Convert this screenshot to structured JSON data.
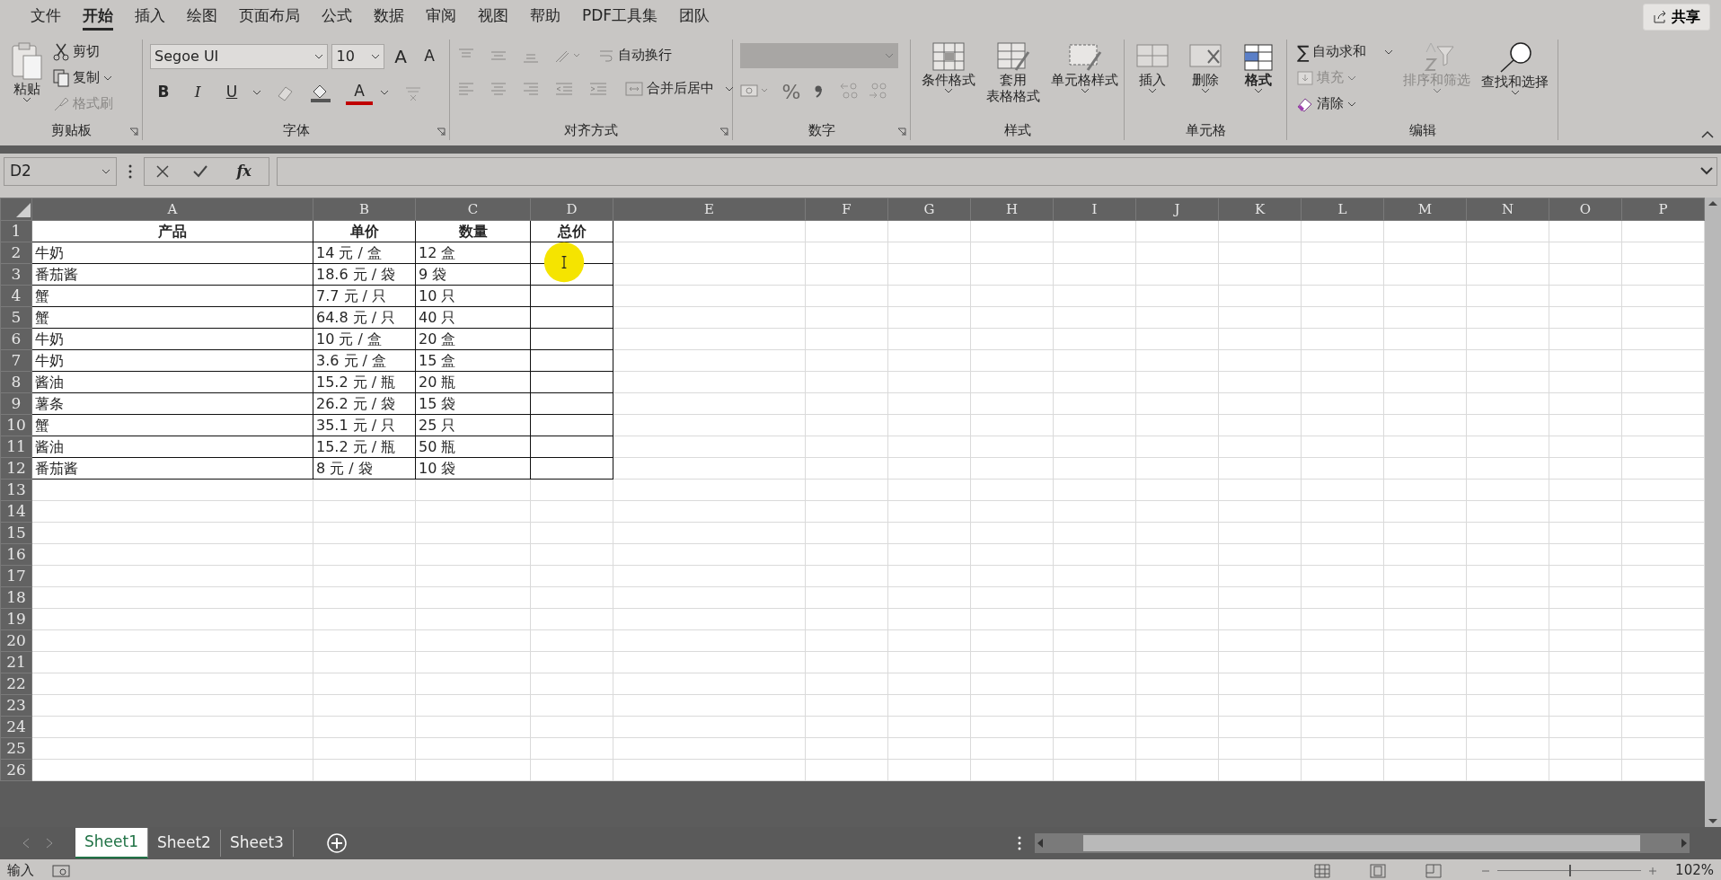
{
  "menu_tabs": [
    {
      "label": "文件",
      "selected": false
    },
    {
      "label": "开始",
      "selected": true
    },
    {
      "label": "插入",
      "selected": false
    },
    {
      "label": "绘图",
      "selected": false
    },
    {
      "label": "页面布局",
      "selected": false
    },
    {
      "label": "公式",
      "selected": false
    },
    {
      "label": "数据",
      "selected": false
    },
    {
      "label": "审阅",
      "selected": false
    },
    {
      "label": "视图",
      "selected": false
    },
    {
      "label": "帮助",
      "selected": false
    },
    {
      "label": "PDF工具集",
      "selected": false
    },
    {
      "label": "团队",
      "selected": false
    }
  ],
  "share_button": "共享",
  "clipboard": {
    "paste": "粘贴",
    "cut": {
      "label": "剪切",
      "disabled": false
    },
    "copy": {
      "label": "复制",
      "disabled": false
    },
    "format_painter": {
      "label": "格式刷",
      "disabled": true
    },
    "group_label": "剪贴板"
  },
  "font": {
    "font_name": "Segoe UI",
    "font_size": "10",
    "grow": "A",
    "shrink": "A",
    "bold": "B",
    "italic": "I",
    "underline": "U",
    "font_color": "A",
    "group_label": "字体"
  },
  "alignment": {
    "wrap_text": "自动换行",
    "merge_center": "合并后居中",
    "group_label": "对齐方式"
  },
  "number": {
    "percent": "%",
    "group_label": "数字"
  },
  "styles": {
    "conditional_format": "条件格式",
    "table_format_line1": "套用",
    "table_format_line2": "表格格式",
    "cell_styles": "单元格样式",
    "group_label": "样式"
  },
  "cells_group": {
    "insert": "插入",
    "delete": "删除",
    "format": "格式",
    "group_label": "单元格"
  },
  "editing": {
    "autosum": {
      "symbol": "∑",
      "label": "自动求和",
      "disabled": false
    },
    "fill": {
      "label": "填充",
      "disabled": true
    },
    "clear": {
      "label": "清除",
      "disabled": false
    },
    "sort_filter": {
      "label": "排序和筛选",
      "disabled": true
    },
    "find_select": {
      "label": "查找和选择",
      "disabled": false
    },
    "group_label": "编辑"
  },
  "formula_bar": {
    "name_box": "D2",
    "function_button": "fx"
  },
  "sheet": {
    "columns": [
      "A",
      "B",
      "C",
      "D",
      "E",
      "F",
      "G",
      "H",
      "I",
      "J",
      "K",
      "L",
      "M",
      "N",
      "O",
      "P"
    ],
    "rows": [
      {
        "number": "1",
        "kind": "header",
        "cells": [
          "产品",
          "单价",
          "数量",
          "总价"
        ]
      },
      {
        "number": "2",
        "kind": "data",
        "cells": [
          "牛奶",
          "14 元 / 盒",
          "12 盒",
          ""
        ]
      },
      {
        "number": "3",
        "kind": "data",
        "cells": [
          "番茄酱",
          "18.6 元 / 袋",
          "9 袋",
          ""
        ]
      },
      {
        "number": "4",
        "kind": "data",
        "cells": [
          "蟹",
          "7.7 元 / 只",
          "10 只",
          ""
        ]
      },
      {
        "number": "5",
        "kind": "data",
        "cells": [
          "蟹",
          "64.8 元 / 只",
          "40 只",
          ""
        ]
      },
      {
        "number": "6",
        "kind": "data",
        "cells": [
          "牛奶",
          "10 元 / 盒",
          "20 盒",
          ""
        ]
      },
      {
        "number": "7",
        "kind": "data",
        "cells": [
          "牛奶",
          "3.6 元 / 盒",
          "15 盒",
          ""
        ]
      },
      {
        "number": "8",
        "kind": "data",
        "cells": [
          "酱油",
          "15.2 元 / 瓶",
          "20 瓶",
          ""
        ]
      },
      {
        "number": "9",
        "kind": "data",
        "cells": [
          "薯条",
          "26.2 元 / 袋",
          "15 袋",
          ""
        ]
      },
      {
        "number": "10",
        "kind": "data",
        "cells": [
          "蟹",
          "35.1 元 / 只",
          "25 只",
          ""
        ]
      },
      {
        "number": "11",
        "kind": "data",
        "cells": [
          "酱油",
          "15.2 元 / 瓶",
          "50 瓶",
          ""
        ]
      },
      {
        "number": "12",
        "kind": "data",
        "cells": [
          "番茄酱",
          "8 元 / 袋",
          "10 袋",
          ""
        ]
      },
      {
        "number": "13"
      },
      {
        "number": "14"
      },
      {
        "number": "15"
      },
      {
        "number": "16"
      },
      {
        "number": "17"
      },
      {
        "number": "18"
      },
      {
        "number": "19"
      },
      {
        "number": "20"
      },
      {
        "number": "21"
      },
      {
        "number": "22"
      },
      {
        "number": "23"
      },
      {
        "number": "24"
      },
      {
        "number": "25"
      },
      {
        "number": "26"
      }
    ]
  },
  "sheet_tabs": [
    {
      "label": "Sheet1",
      "selected": true
    },
    {
      "label": "Sheet2",
      "selected": false
    },
    {
      "label": "Sheet3",
      "selected": false
    }
  ],
  "status_bar": {
    "mode": "输入",
    "zoom_slider": {
      "level": 0.5
    },
    "zoom": "102%"
  }
}
